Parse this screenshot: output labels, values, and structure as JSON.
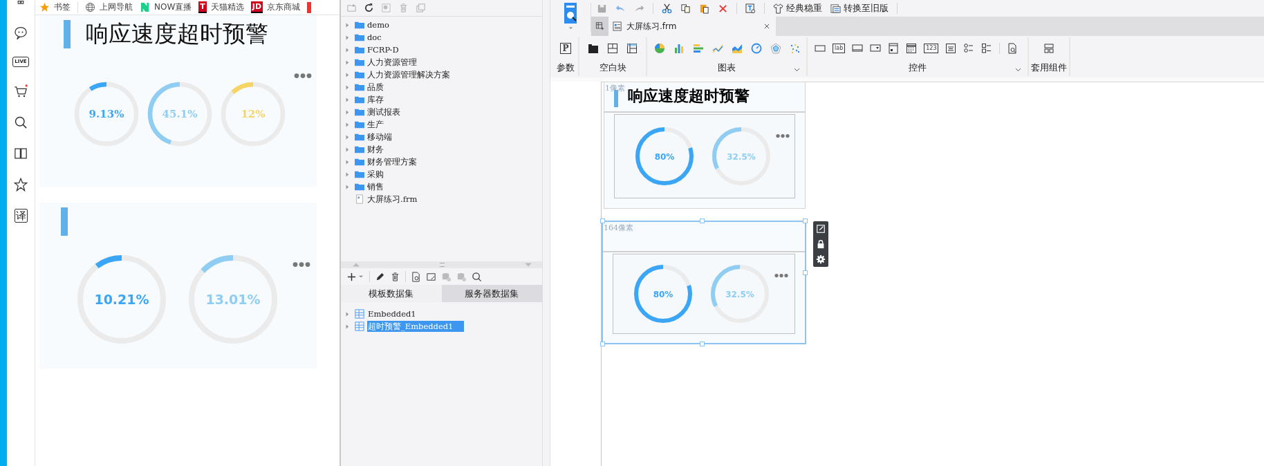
{
  "browser": {
    "bookmarks": [
      {
        "kind": "star",
        "label": "书签"
      },
      {
        "kind": "globe",
        "label": "上网导航"
      },
      {
        "kind": "now",
        "label": "NOW直播"
      },
      {
        "kind": "letter",
        "icon_text": "T",
        "label": "天猫精选"
      },
      {
        "kind": "letter",
        "icon_text": "JD",
        "label": "京东商城"
      }
    ],
    "sidebar": [
      {
        "kind": "bag"
      },
      {
        "kind": "chat"
      },
      {
        "kind": "live",
        "icon_text": "LIVE"
      },
      {
        "kind": "cart"
      },
      {
        "kind": "search"
      },
      {
        "kind": "book"
      },
      {
        "kind": "star"
      },
      {
        "kind": "translate",
        "icon_text": "译"
      }
    ],
    "panels": [
      {
        "title": "响应速度超时预警",
        "gauges": [
          {
            "value": "9.13%",
            "level": 0.0913,
            "color": "#3ba6f5"
          },
          {
            "value": "45.1%",
            "level": 0.451,
            "color": "#8fcdf3"
          },
          {
            "value": "12%",
            "level": 0.12,
            "color": "#f6d564"
          }
        ]
      },
      {
        "gauges": [
          {
            "value": "10.21%",
            "level": 0.1021,
            "color": "#3ba6f5"
          },
          {
            "value": "13.01%",
            "level": 0.1301,
            "color": "#8fcdf3"
          }
        ]
      }
    ]
  },
  "tree": {
    "items": [
      {
        "kind": "folder",
        "label": "demo"
      },
      {
        "kind": "folder",
        "label": "doc"
      },
      {
        "kind": "folder",
        "label": "FCRP-D"
      },
      {
        "kind": "folder",
        "label": "人力资源管理"
      },
      {
        "kind": "folder",
        "label": "人力资源管理解决方案"
      },
      {
        "kind": "folder",
        "label": "品质"
      },
      {
        "kind": "folder",
        "label": "库存"
      },
      {
        "kind": "folder",
        "label": "测试报表"
      },
      {
        "kind": "folder",
        "label": "生产"
      },
      {
        "kind": "folder",
        "label": "移动端"
      },
      {
        "kind": "folder",
        "label": "财务"
      },
      {
        "kind": "folder",
        "label": "财务管理方案"
      },
      {
        "kind": "folder",
        "label": "采购"
      },
      {
        "kind": "folder",
        "label": "销售"
      },
      {
        "kind": "file",
        "label": "大屏练习.frm"
      }
    ]
  },
  "datasets": {
    "tabs": [
      {
        "label": "模板数据集",
        "selected": true
      },
      {
        "label": "服务器数据集",
        "selected": false
      }
    ],
    "items": [
      {
        "label": "Embedded1",
        "selected": false
      },
      {
        "label": "超时预警_Embedded1",
        "selected": true
      }
    ]
  },
  "designer": {
    "toolbar_buttons": [
      {
        "kind": "shirt",
        "label": "经典稳重"
      },
      {
        "kind": "convert",
        "label": "转换至旧版"
      }
    ],
    "tab": {
      "label": "大屏练习.frm"
    },
    "ribbon": [
      {
        "label": "参数",
        "dropdown": false,
        "icons": [
          {
            "kind": "param",
            "text": "P"
          }
        ]
      },
      {
        "label": "空白块",
        "dropdown": false,
        "icons": [
          {
            "kind": "block-solid"
          },
          {
            "kind": "block-grid"
          },
          {
            "kind": "block-table"
          }
        ]
      },
      {
        "label": "图表",
        "dropdown": true,
        "icons": [
          {
            "kind": "pie"
          },
          {
            "kind": "bar"
          },
          {
            "kind": "hbar"
          },
          {
            "kind": "line"
          },
          {
            "kind": "area"
          },
          {
            "kind": "gauge"
          },
          {
            "kind": "radar"
          },
          {
            "kind": "scatter"
          }
        ]
      },
      {
        "label": "控件",
        "dropdown": true,
        "icons": [
          {
            "kind": "rect"
          },
          {
            "kind": "label",
            "text": "lab"
          },
          {
            "kind": "button"
          },
          {
            "kind": "dropdown"
          },
          {
            "kind": "form"
          },
          {
            "kind": "calendar"
          },
          {
            "kind": "number",
            "text": "123"
          },
          {
            "kind": "list"
          },
          {
            "kind": "radio"
          },
          {
            "kind": "checkbox"
          },
          {
            "kind": "preview"
          }
        ]
      },
      {
        "label": "套用组件",
        "dropdown": false,
        "icons": [
          {
            "kind": "layout"
          }
        ]
      }
    ],
    "widgets": [
      {
        "size_label": "1像素",
        "title": "响应速度超时预警",
        "selected": false,
        "gauges": [
          {
            "value": "80%",
            "level": 0.8,
            "color": "#3ba6f5"
          },
          {
            "value": "32.5%",
            "level": 0.325,
            "color": "#8fcdf3"
          }
        ]
      },
      {
        "size_label": "164像素",
        "selected": true,
        "gauges": [
          {
            "value": "80%",
            "level": 0.8,
            "color": "#3ba6f5"
          },
          {
            "value": "32.5%",
            "level": 0.325,
            "color": "#8fcdf3"
          }
        ]
      }
    ]
  }
}
